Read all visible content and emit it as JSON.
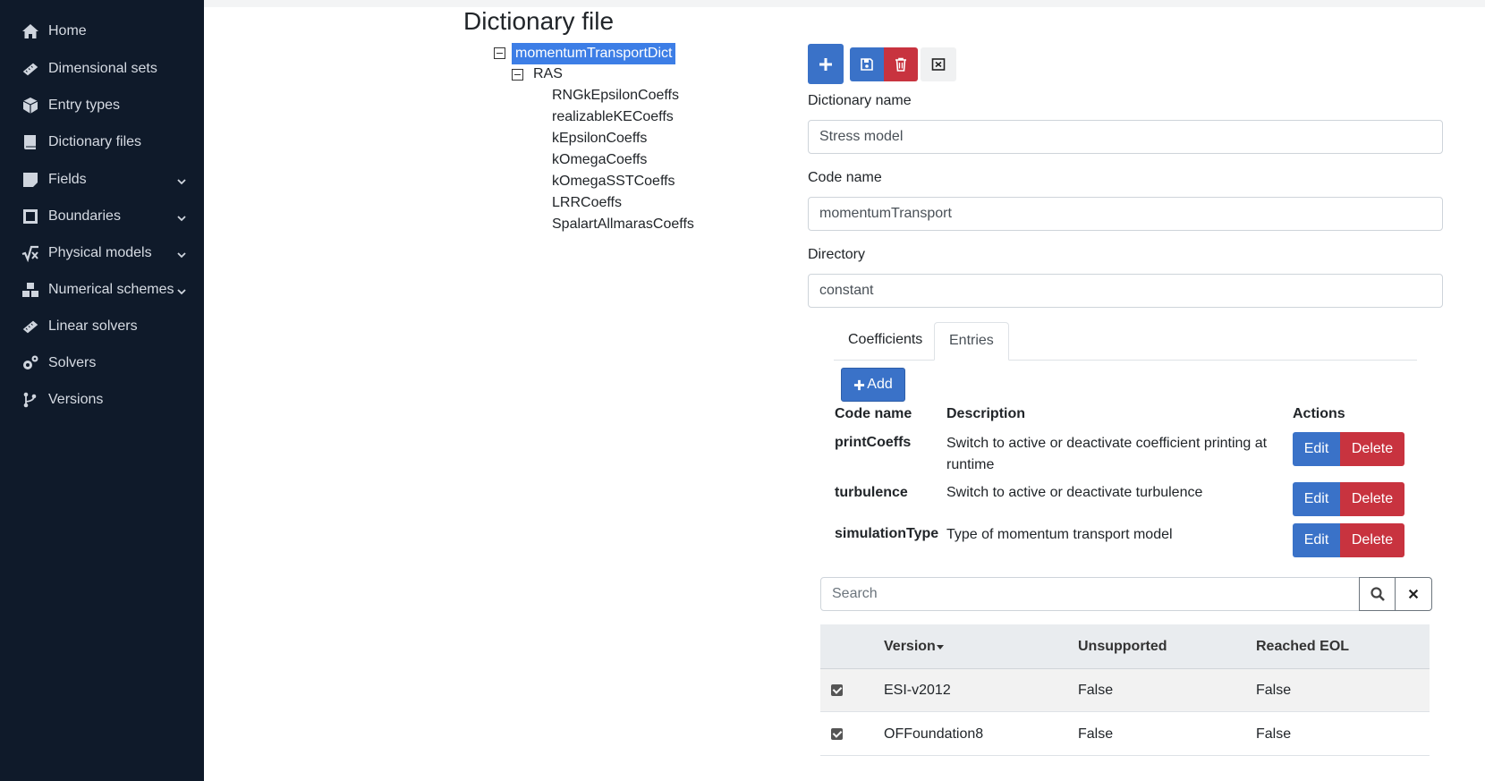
{
  "sidebar": {
    "items": [
      {
        "label": "Home",
        "icon": "home-icon"
      },
      {
        "label": "Dimensional sets",
        "icon": "ruler-icon"
      },
      {
        "label": "Entry types",
        "icon": "cube-icon"
      },
      {
        "label": "Dictionary files",
        "icon": "book-icon"
      },
      {
        "label": "Fields",
        "icon": "note-icon",
        "expandable": true
      },
      {
        "label": "Boundaries",
        "icon": "border-icon",
        "expandable": true
      },
      {
        "label": "Physical models",
        "icon": "square-root-icon",
        "expandable": true
      },
      {
        "label": "Numerical schemes",
        "icon": "cubes-icon",
        "expandable": true
      },
      {
        "label": "Linear solvers",
        "icon": "ruler-icon"
      },
      {
        "label": "Solvers",
        "icon": "cogs-icon"
      },
      {
        "label": "Versions",
        "icon": "code-branch-icon"
      }
    ]
  },
  "page": {
    "title": "Dictionary file"
  },
  "tree": {
    "root": "momentumTransportDict",
    "child": "RAS",
    "leaves": [
      "RNGkEpsilonCoeffs",
      "realizableKECoeffs",
      "kEpsilonCoeffs",
      "kOmegaCoeffs",
      "kOmegaSSTCoeffs",
      "LRRCoeffs",
      "SpalartAllmarasCoeffs"
    ]
  },
  "form": {
    "dict_name_label": "Dictionary name",
    "dict_name_value": "Stress model",
    "code_name_label": "Code name",
    "code_name_value": "momentumTransport",
    "directory_label": "Directory",
    "directory_value": "constant"
  },
  "tabs": {
    "coefficients": "Coefficients",
    "entries": "Entries",
    "active": "Entries"
  },
  "entries": {
    "add_label": "Add",
    "headers": {
      "code": "Code name",
      "desc": "Description",
      "actions": "Actions"
    },
    "edit_label": "Edit",
    "delete_label": "Delete",
    "rows": [
      {
        "code": "printCoeffs",
        "desc": "Switch to active or deactivate coefficient printing at runtime"
      },
      {
        "code": "turbulence",
        "desc": "Switch to active or deactivate turbulence"
      },
      {
        "code": "simulationType",
        "desc": "Type of momentum transport model"
      }
    ]
  },
  "search": {
    "placeholder": "Search"
  },
  "versions": {
    "headers": {
      "version": "Version",
      "unsupported": "Unsupported",
      "eol": "Reached EOL"
    },
    "rows": [
      {
        "version": "ESI-v2012",
        "unsupported": "False",
        "eol": "False",
        "checked": true
      },
      {
        "version": "OFFoundation8",
        "unsupported": "False",
        "eol": "False",
        "checked": true
      }
    ]
  },
  "colors": {
    "sidebar": "#0f1a2a",
    "primary": "#3a72c8",
    "danger": "#c8333f",
    "selection": "#3d7ee6"
  }
}
